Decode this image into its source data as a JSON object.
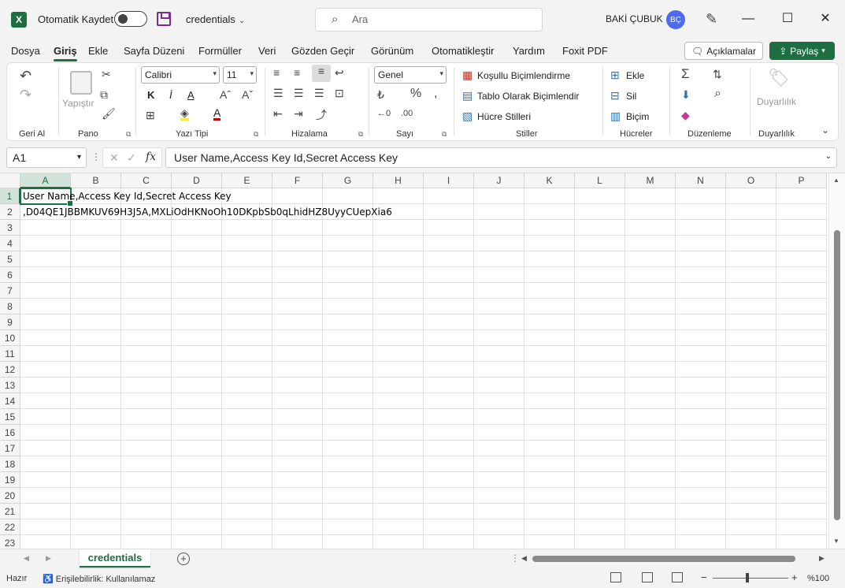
{
  "titlebar": {
    "autosave_label": "Otomatik Kaydet",
    "doc_title": "credentials",
    "search_placeholder": "Ara",
    "user_name": "BAKİ ÇUBUK",
    "user_initials": "BÇ"
  },
  "menu": {
    "tabs": [
      "Dosya",
      "Giriş",
      "Ekle",
      "Sayfa Düzeni",
      "Formüller",
      "Veri",
      "Gözden Geçir",
      "Görünüm",
      "Otomatikleştir",
      "Yardım",
      "Foxit PDF"
    ],
    "active_tab": "Giriş",
    "comments_label": "Açıklamalar",
    "share_label": "Paylaş"
  },
  "ribbon": {
    "groups": {
      "undo": "Geri Al",
      "clipboard": "Pano",
      "font": "Yazı Tipi",
      "alignment": "Hizalama",
      "number": "Sayı",
      "styles": "Stiller",
      "cells": "Hücreler",
      "editing": "Düzenleme",
      "sensitivity": "Duyarlılık"
    },
    "paste_label": "Yapıştır",
    "font_name": "Calibri",
    "font_size": "11",
    "bold": "K",
    "italic": "İ",
    "underline": "A",
    "font_color": "A",
    "number_format": "Genel",
    "conditional_formatting": "Koşullu Biçimlendirme",
    "format_as_table": "Tablo Olarak Biçimlendir",
    "cell_styles": "Hücre Stilleri",
    "insert": "Ekle",
    "delete": "Sil",
    "format": "Biçim",
    "sensitivity_button": "Duyarlılık"
  },
  "formula_bar": {
    "name_box": "A1",
    "fx": "fx",
    "formula": "User Name,Access Key Id,Secret Access Key"
  },
  "grid": {
    "columns": [
      "A",
      "B",
      "C",
      "D",
      "E",
      "F",
      "G",
      "H",
      "I",
      "J",
      "K",
      "L",
      "M",
      "N",
      "O",
      "P"
    ],
    "rows": [
      "1",
      "2",
      "3",
      "4",
      "5",
      "6",
      "7",
      "8",
      "9",
      "10",
      "11",
      "12",
      "13",
      "14",
      "15",
      "16",
      "17",
      "18",
      "19",
      "20",
      "21",
      "22",
      "23"
    ],
    "cells": {
      "A1": "User Name,Access Key Id,Secret Access Key",
      "A2": ",D04QE1JBBMKUV69H3J5A,MXLiOdHKNoOh10DKpbSb0qLhidHZ8UyyCUepXia6"
    },
    "selected_cell": "A1"
  },
  "sheets": {
    "tabs": [
      "credentials"
    ],
    "active": "credentials"
  },
  "statusbar": {
    "ready": "Hazır",
    "accessibility": "Erişilebilirlik: Kullanılamaz",
    "zoom": "%100"
  },
  "colors": {
    "accent": "#1d6f42",
    "avatar": "#4f6bed"
  }
}
